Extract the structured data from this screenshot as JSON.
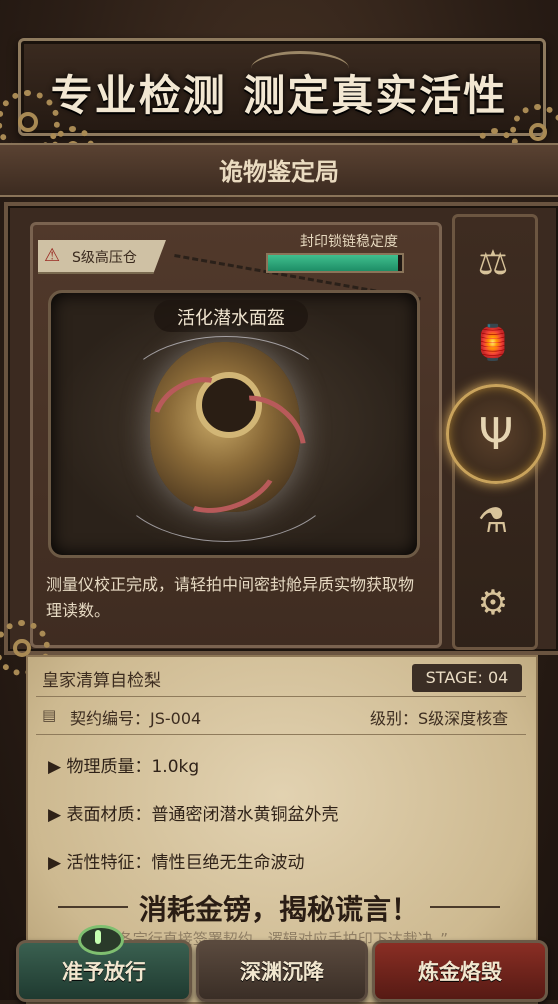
{
  "header": {
    "headline": "专业检测 测定真实活性",
    "subtitle": "诡物鉴定局"
  },
  "vault": {
    "warning_icon": "warning-triangle-icon",
    "warning_label": "S级高压仓",
    "seal_label": "封印锁链稳定度",
    "seal_stability": 0.97,
    "item_name": "活化潜水面盔",
    "hint": "测量仪校正完成，请轻拍中间密封舱异质实物获取物理读数。"
  },
  "toolbar": {
    "items": [
      {
        "name": "scales-skull-icon",
        "glyph": "⚖",
        "selected": false
      },
      {
        "name": "mushroom-lantern-icon",
        "glyph": "🏮",
        "selected": false
      },
      {
        "name": "tuning-fork-icon",
        "glyph": "Ψ",
        "selected": true
      },
      {
        "name": "potion-bottles-icon",
        "glyph": "⚗",
        "selected": false
      },
      {
        "name": "brass-device-icon",
        "glyph": "⚙",
        "selected": false
      }
    ]
  },
  "report": {
    "title": "皇家清算自检梨",
    "stage": "STAGE: 04",
    "contract": "契约编号：JS-004",
    "level": "级别：S级深度核查",
    "attributes": [
      "▶ 物理质量：1.0kg",
      "▶ 表面材质：普通密闭潜水黄铜盆外壳",
      "▶ 活性特征：情性巨绝无生命波动"
    ],
    "cta": "消耗金镑，揭秘谎言！",
    "faded_quote": "“各宗行直接签署契约，逻辑对应手拍印下达裁决。”"
  },
  "buttons": {
    "approve": "准予放行",
    "abyss": "深渊沉降",
    "burn": "炼金烙毁"
  },
  "colors": {
    "accent_gold": "#c9a35c",
    "seal_green": "#3fbf8e",
    "approve_green": "#2f5547",
    "burn_red": "#7a2620",
    "parchment": "#d8c7a3"
  }
}
